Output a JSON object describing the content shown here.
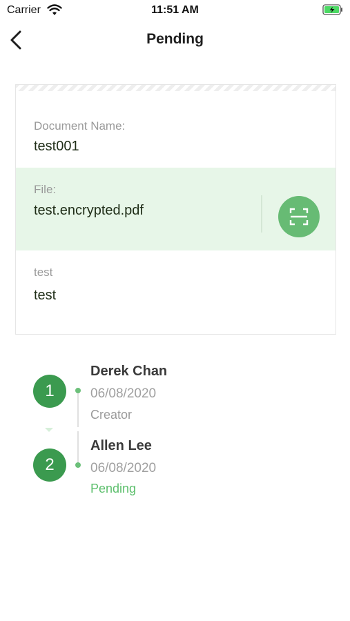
{
  "status_bar": {
    "carrier": "Carrier",
    "time": "11:51 AM"
  },
  "nav": {
    "title": "Pending"
  },
  "document": {
    "name_label": "Document Name:",
    "name_value": "test001",
    "file_label": "File:",
    "file_value": "test.encrypted.pdf",
    "extra_label": "test",
    "extra_value": "test"
  },
  "timeline": [
    {
      "step": "1",
      "name": "Derek Chan",
      "date": "06/08/2020",
      "status": "Creator",
      "status_color": "#9a9a9a"
    },
    {
      "step": "2",
      "name": "Allen Lee",
      "date": "06/08/2020",
      "status": "Pending",
      "status_color": "#5cbf6c"
    }
  ],
  "colors": {
    "accent": "#3b9a4f",
    "scan_button": "#67bb74",
    "file_bg": "#e7f6e8"
  }
}
